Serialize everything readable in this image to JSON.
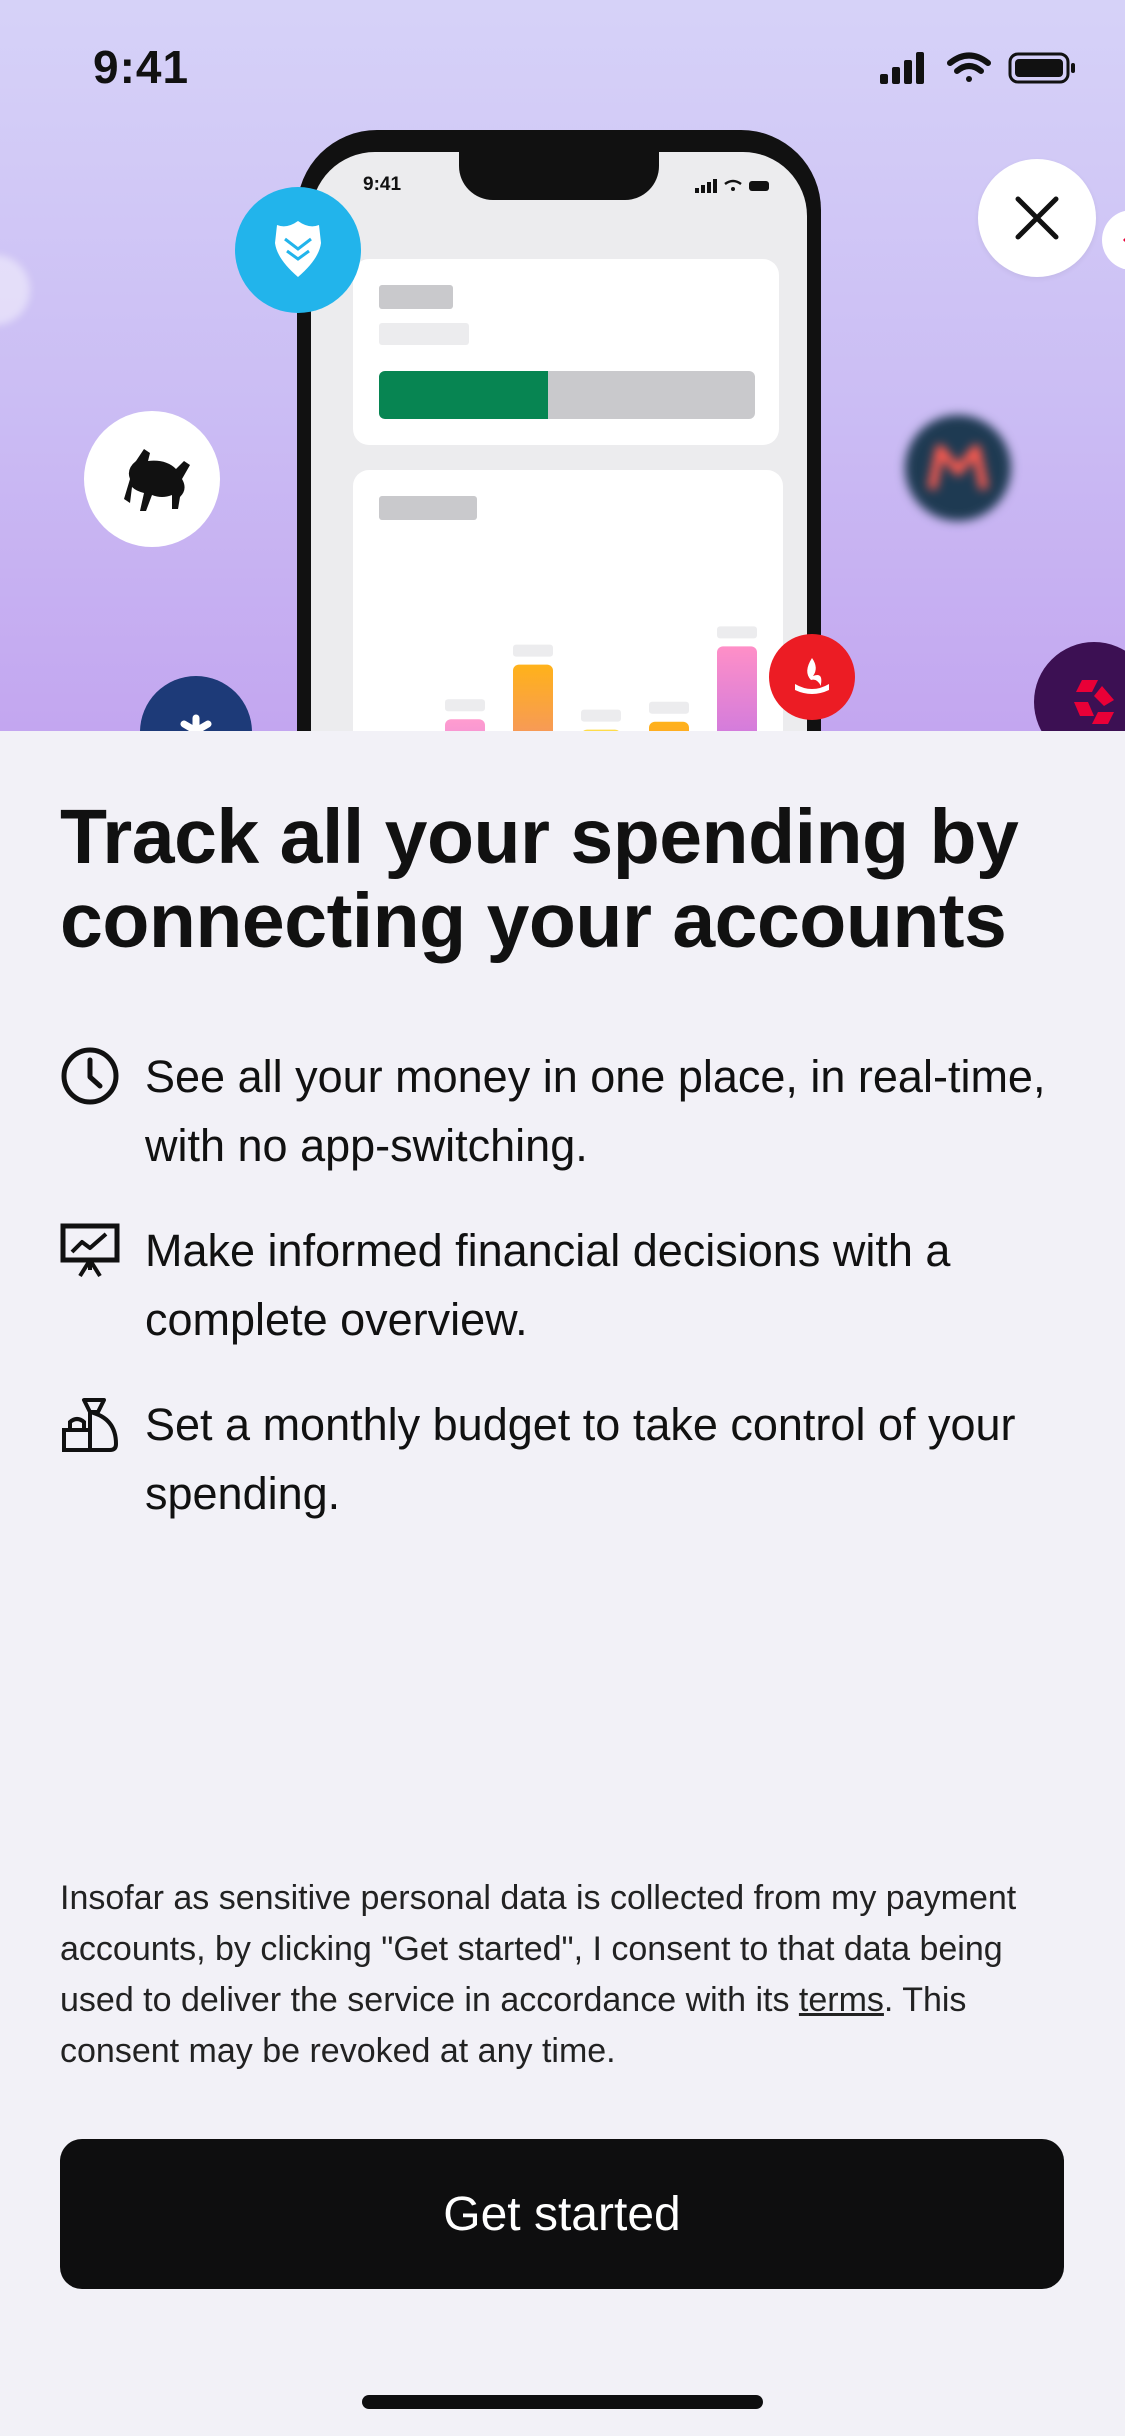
{
  "status_bar": {
    "time": "9:41"
  },
  "hero": {
    "mockup": {
      "time": "9:41",
      "summary_progress": 0.45,
      "bar_gradients": [
        [
          "#5fd3ff",
          "#4aa8ff"
        ],
        [
          "#ff9ccf",
          "#b066f5"
        ],
        [
          "#ffb21a",
          "#e667d8"
        ],
        [
          "#ffdc4a",
          "#a6d83e"
        ],
        [
          "#ffb21a",
          "#ff6a8a"
        ],
        [
          "#ff8fc7",
          "#8a5cff"
        ]
      ],
      "bar_levels": [
        0.12,
        0.58,
        0.79,
        0.54,
        0.57,
        0.86
      ]
    },
    "bank_logos": [
      "barclays-logo",
      "lloyds-logo",
      "monzo-logo",
      "santander-logo",
      "natwest-logo"
    ],
    "close_label": "Close"
  },
  "headline": "Track all your spending by connecting your accounts",
  "features": [
    {
      "icon": "clock-icon",
      "text": "See all your money in one place, in real-time, with no app-switching."
    },
    {
      "icon": "presentation-chart-icon",
      "text": "Make informed financial decisions with a complete overview."
    },
    {
      "icon": "money-bag-icon",
      "text": "Set a monthly budget to take control of your spending."
    }
  ],
  "consent": {
    "before": "Insofar as sensitive personal data is collected from my payment accounts, by clicking \"Get started\", I consent to that data being used to deliver the service in accordance with its ",
    "link": "terms",
    "after": ". This consent may be revoked at any time."
  },
  "cta": {
    "label": "Get started"
  },
  "colors": {
    "accent_green": "#078552",
    "barclays": "#22b4eb",
    "santander": "#ec1c24",
    "natwest": "#3c1053",
    "button": "#0e0e0f"
  }
}
